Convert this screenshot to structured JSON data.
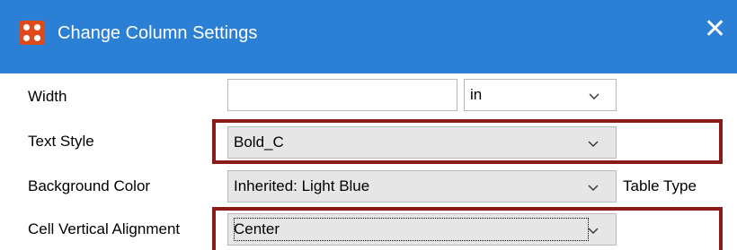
{
  "window": {
    "title": "Change Column Settings",
    "close_glyph": "✕",
    "icon": "app-grid-icon",
    "accent": "#2b7fd4",
    "icon_color": "#e04a1a",
    "highlight_color": "#8b1a1a"
  },
  "rows": {
    "width": {
      "label": "Width",
      "value": "",
      "unit": "in"
    },
    "text_style": {
      "label": "Text Style",
      "value": "Bold_C"
    },
    "background_color": {
      "label": "Background Color",
      "value": "Inherited: Light Blue"
    },
    "cell_vertical_alignment": {
      "label": "Cell Vertical Alignment",
      "value": "Center"
    }
  },
  "table_type_label": "Table Type",
  "chevron_icon": "chevron-down-icon"
}
